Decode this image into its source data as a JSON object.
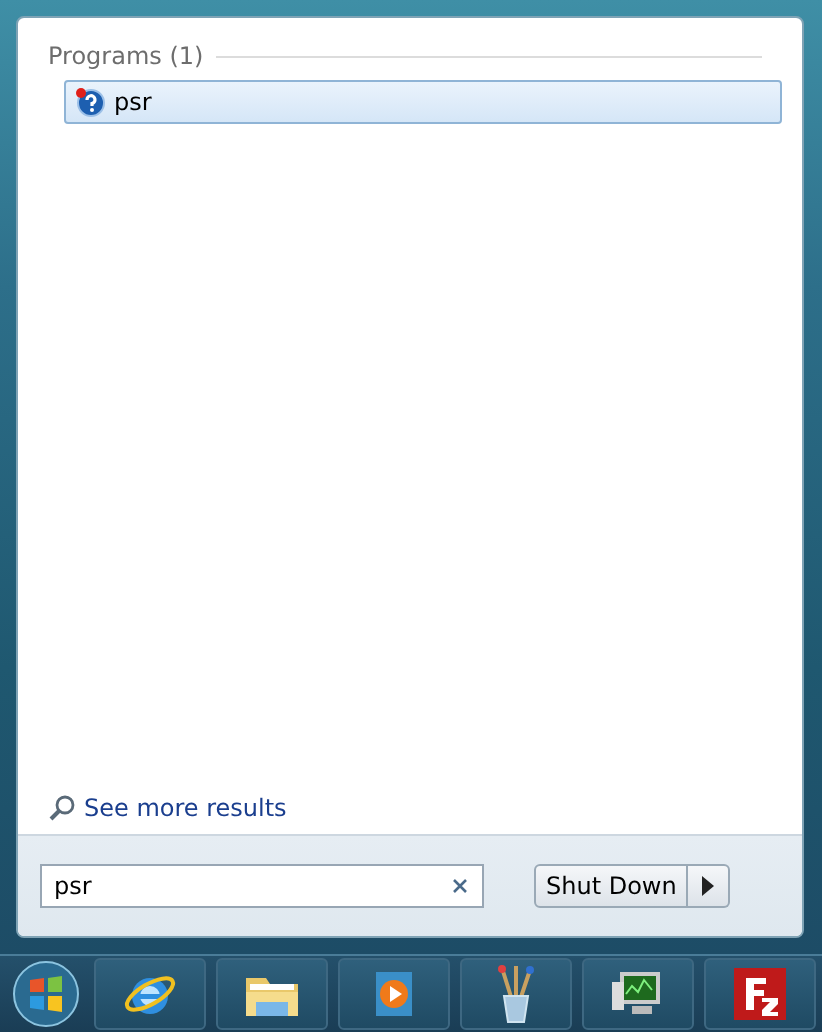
{
  "results": {
    "group": "Programs (1)",
    "items": [
      {
        "label": "psr",
        "selected": true
      }
    ]
  },
  "see_more": "See more results",
  "search": {
    "value": "psr"
  },
  "shut_down": {
    "label": "Shut Down"
  },
  "taskbar": [
    {
      "kind": "browser"
    },
    {
      "kind": "folder"
    },
    {
      "kind": "media"
    },
    {
      "kind": "paint"
    },
    {
      "kind": "monitor"
    },
    {
      "kind": "ftp"
    }
  ]
}
